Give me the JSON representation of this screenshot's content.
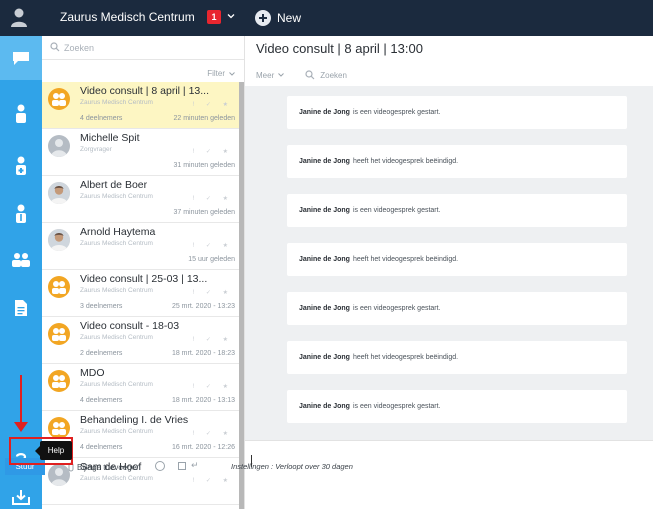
{
  "topbar": {
    "org_name": "Zaurus Medisch Centrum",
    "badge_count": "1",
    "new_label": "New"
  },
  "list": {
    "search_placeholder": "Zoeken",
    "filter_label": "Filter",
    "items": [
      {
        "title": "Video consult | 8 april | 13...",
        "subtitle": "Zaurus Medisch Centrum",
        "count": "4 deelnemers",
        "time": "22 minuten geleden",
        "avatar": "group",
        "selected": true
      },
      {
        "title": "Michelle Spit",
        "subtitle": "Zorgvrager",
        "count": "",
        "time": "31 minuten geleden",
        "avatar": "person",
        "selected": false
      },
      {
        "title": "Albert de Boer",
        "subtitle": "Zaurus Medisch Centrum",
        "count": "",
        "time": "37 minuten geleden",
        "avatar": "photo",
        "selected": false
      },
      {
        "title": "Arnold Haytema",
        "subtitle": "Zaurus Medisch Centrum",
        "count": "",
        "time": "15 uur geleden",
        "avatar": "photo",
        "selected": false
      },
      {
        "title": "Video consult | 25-03 | 13...",
        "subtitle": "Zaurus Medisch Centrum",
        "count": "3 deelnemers",
        "time": "25 mrt. 2020 - 13:23",
        "avatar": "group",
        "selected": false
      },
      {
        "title": "Video consult - 18-03",
        "subtitle": "Zaurus Medisch Centrum",
        "count": "2 deelnemers",
        "time": "18 mrt. 2020 - 18:23",
        "avatar": "group",
        "selected": false
      },
      {
        "title": "MDO",
        "subtitle": "Zaurus Medisch Centrum",
        "count": "4 deelnemers",
        "time": "18 mrt. 2020 - 13:13",
        "avatar": "group",
        "selected": false
      },
      {
        "title": "Behandeling I. de Vries",
        "subtitle": "Zaurus Medisch Centrum",
        "count": "4 deelnemers",
        "time": "16 mrt. 2020 - 12:26",
        "avatar": "group",
        "selected": false
      },
      {
        "title": "Sam de Hoof",
        "subtitle": "Zaurus Medisch Centrum",
        "count": "",
        "time": "",
        "avatar": "person",
        "selected": false
      }
    ]
  },
  "rail": {
    "help_tooltip": "Help"
  },
  "main": {
    "title": "Video consult | 8 april | 13:00",
    "more_label": "Meer",
    "search_placeholder": "Zoeken",
    "messages": [
      {
        "author": "Janine de Jong",
        "text": "is een videogesprek gestart."
      },
      {
        "author": "Janine de Jong",
        "text": "heeft het videogesprek beëindigd."
      },
      {
        "author": "Janine de Jong",
        "text": "is een videogesprek gestart."
      },
      {
        "author": "Janine de Jong",
        "text": "heeft het videogesprek beëindigd."
      },
      {
        "author": "Janine de Jong",
        "text": "is een videogesprek gestart."
      },
      {
        "author": "Janine de Jong",
        "text": "heeft het videogesprek beëindigd."
      },
      {
        "author": "Janine de Jong",
        "text": "is een videogesprek gestart."
      }
    ],
    "compose": {
      "send_label": "Stuur",
      "attach_label": "Bijlage toevoegen",
      "settings_text": "Instellingen : Verloopt over 30 dagen"
    }
  },
  "colors": {
    "topbar": "#1b2a3e",
    "rail": "#30a3e8",
    "selected_item": "#fdf6c3",
    "badge": "#e8262f",
    "send_button": "#2f99e6",
    "annotation": "#e02020"
  }
}
